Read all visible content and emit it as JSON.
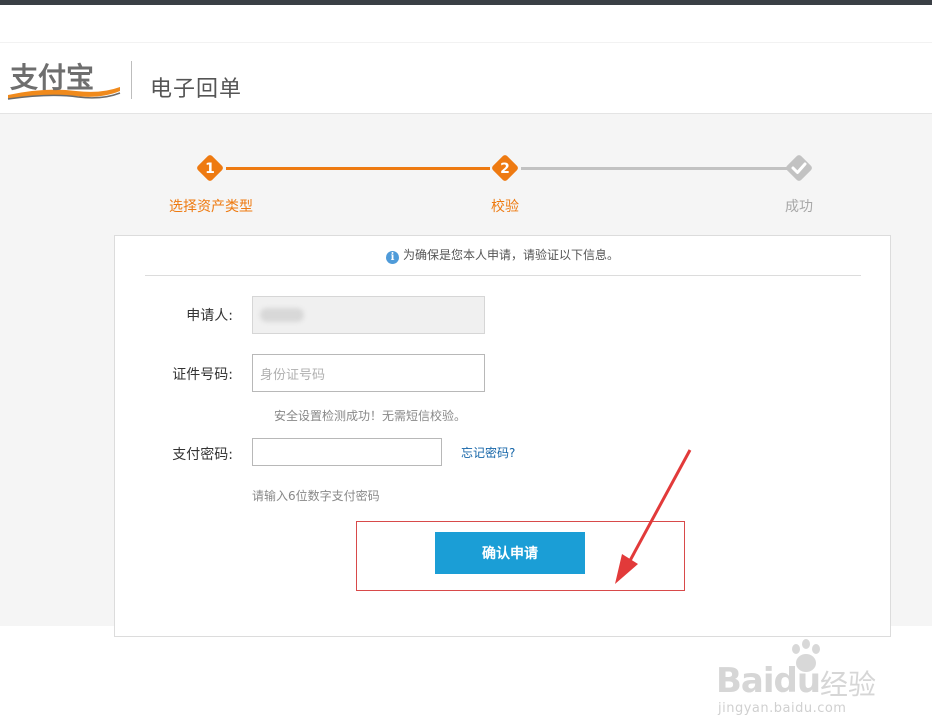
{
  "header": {
    "logo_text": "支付宝",
    "product_title": "电子回单"
  },
  "steps": [
    {
      "number": "1",
      "label": "选择资产类型",
      "status": "done"
    },
    {
      "number": "2",
      "label": "校验",
      "status": "current"
    },
    {
      "number": "",
      "label": "成功",
      "status": "pending"
    }
  ],
  "colors": {
    "accent_orange": "#ee7a11",
    "inactive_grey": "#c2c2c2",
    "button_blue": "#1b9ed6",
    "highlight_red": "#d84a4a",
    "info_blue": "#4f9bd9",
    "link_blue": "#1565a8"
  },
  "form": {
    "notice_icon": "info-icon",
    "notice_text": "为确保是您本人申请，请验证以下信息。",
    "applicant_label": "申请人:",
    "applicant_value": "",
    "id_label": "证件号码:",
    "id_placeholder": "身份证号码",
    "security_note": "安全设置检测成功！无需短信校验。",
    "password_label": "支付密码:",
    "forgot_link": "忘记密码?",
    "password_hint": "请输入6位数字支付密码",
    "confirm_button": "确认申请"
  },
  "watermark": {
    "brand": "Bai",
    "brand_tail": "du",
    "text": "经验",
    "url": "jingyan.baidu.com"
  }
}
